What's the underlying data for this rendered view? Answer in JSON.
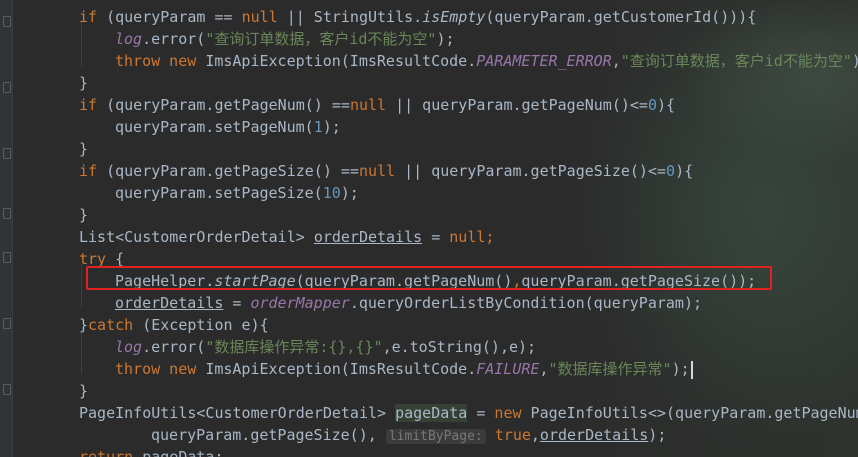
{
  "editor": {
    "lines": [
      {
        "indent": 0,
        "segments": [
          {
            "t": "if",
            "c": "kw"
          },
          {
            "t": " (queryParam == "
          },
          {
            "t": "null",
            "c": "kw"
          },
          {
            "t": " || StringUtils."
          },
          {
            "t": "isEmpty",
            "c": "ital"
          },
          {
            "t": "(queryParam.getCustomerId())){"
          }
        ]
      },
      {
        "indent": 1,
        "segments": [
          {
            "t": "log",
            "c": "fld"
          },
          {
            "t": ".error("
          },
          {
            "t": "\"查询订单数据，客户id不能为空\"",
            "c": "str"
          },
          {
            "t": ");"
          }
        ]
      },
      {
        "indent": 1,
        "segments": [
          {
            "t": "throw new ",
            "c": "kw"
          },
          {
            "t": "ImsApiException(ImsResultCode."
          },
          {
            "t": "PARAMETER_ERROR",
            "c": "fld"
          },
          {
            "t": ","
          },
          {
            "t": "\"查询订单数据，客户id不能为空\"",
            "c": "str"
          },
          {
            "t": ");"
          }
        ]
      },
      {
        "indent": 0,
        "segments": [
          {
            "t": "}"
          }
        ]
      },
      {
        "indent": 0,
        "segments": [
          {
            "t": "if",
            "c": "kw"
          },
          {
            "t": " (queryParam.getPageNum() =="
          },
          {
            "t": "null",
            "c": "kw"
          },
          {
            "t": " || queryParam.getPageNum()<="
          },
          {
            "t": "0",
            "c": "num"
          },
          {
            "t": "){"
          }
        ]
      },
      {
        "indent": 1,
        "segments": [
          {
            "t": "queryParam.setPageNum("
          },
          {
            "t": "1",
            "c": "num"
          },
          {
            "t": ");"
          }
        ]
      },
      {
        "indent": 0,
        "segments": [
          {
            "t": "}"
          }
        ]
      },
      {
        "indent": 0,
        "segments": [
          {
            "t": "if",
            "c": "kw"
          },
          {
            "t": " (queryParam.getPageSize() =="
          },
          {
            "t": "null",
            "c": "kw"
          },
          {
            "t": " || queryParam.getPageSize()<="
          },
          {
            "t": "0",
            "c": "num"
          },
          {
            "t": "){"
          }
        ]
      },
      {
        "indent": 1,
        "segments": [
          {
            "t": "queryParam.setPageSize("
          },
          {
            "t": "10",
            "c": "num"
          },
          {
            "t": ");"
          }
        ]
      },
      {
        "indent": 0,
        "segments": [
          {
            "t": "}"
          }
        ]
      },
      {
        "indent": 0,
        "segments": [
          {
            "t": "List<CustomerOrderDetail> "
          },
          {
            "t": "orderDetails",
            "c": "ul"
          },
          {
            "t": " = "
          },
          {
            "t": "null",
            "c": "kw"
          },
          {
            "t": ";",
            "c": "kw"
          }
        ]
      },
      {
        "indent": 0,
        "segments": [
          {
            "t": "try",
            "c": "kw"
          },
          {
            "t": " {"
          }
        ]
      },
      {
        "indent": 1,
        "segments": [
          {
            "t": "PageHelper."
          },
          {
            "t": "startPage",
            "c": "ital"
          },
          {
            "t": "(queryParam.getPageNum()"
          },
          {
            "t": ",",
            "c": "kw"
          },
          {
            "t": "queryParam.getPageSize());"
          }
        ]
      },
      {
        "indent": 1,
        "segments": [
          {
            "t": "orderDetails",
            "c": "ul"
          },
          {
            "t": " = "
          },
          {
            "t": "orderMapper",
            "c": "fld"
          },
          {
            "t": ".queryOrderListByCondition(queryParam);"
          }
        ]
      },
      {
        "indent": 0,
        "segments": [
          {
            "t": "}"
          },
          {
            "t": "catch",
            "c": "kw"
          },
          {
            "t": " (Exception e){"
          }
        ]
      },
      {
        "indent": 1,
        "segments": [
          {
            "t": "log",
            "c": "fld"
          },
          {
            "t": ".error("
          },
          {
            "t": "\"数据库操作异常:{},{}\"",
            "c": "str"
          },
          {
            "t": ",e.toString(),e);"
          }
        ]
      },
      {
        "indent": 1,
        "segments": [
          {
            "t": "throw new ",
            "c": "kw"
          },
          {
            "t": "ImsApiException(ImsResultCode."
          },
          {
            "t": "FAILURE",
            "c": "fld"
          },
          {
            "t": ","
          },
          {
            "t": "\"数据库操作异常\"",
            "c": "str"
          },
          {
            "t": ");"
          }
        ]
      },
      {
        "indent": 0,
        "segments": [
          {
            "t": "}"
          }
        ]
      },
      {
        "indent": 0,
        "segments": [
          {
            "t": "PageInfoUtils<CustomerOrderDetail> "
          },
          {
            "t": "pageData",
            "c": "hl"
          },
          {
            "t": " = "
          },
          {
            "t": "new",
            "c": "kw"
          },
          {
            "t": " PageInfoUtils<>(queryParam.getPageNum"
          }
        ]
      },
      {
        "indent": 2,
        "segments": [
          {
            "t": "queryParam.getPageSize(), "
          },
          {
            "t": "limitByPage:",
            "c": "hint"
          },
          {
            "t": " "
          },
          {
            "t": "true",
            "c": "kw"
          },
          {
            "t": ","
          },
          {
            "t": "orderDetails",
            "c": "ul"
          },
          {
            "t": ");"
          }
        ]
      },
      {
        "indent": 0,
        "segments": [
          {
            "t": "return",
            "c": "kw"
          },
          {
            "t": " pageData;"
          }
        ]
      }
    ]
  }
}
